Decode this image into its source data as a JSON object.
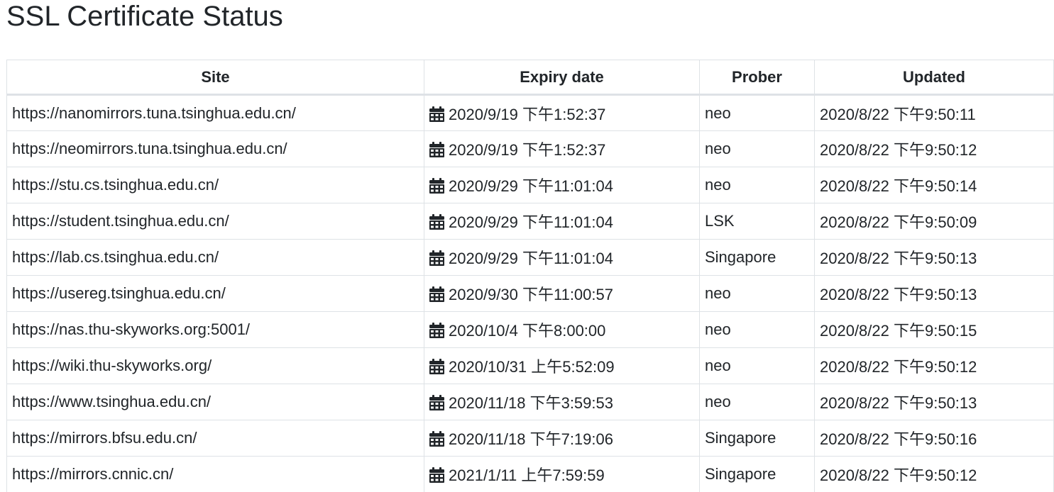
{
  "page": {
    "title": "SSL Certificate Status"
  },
  "table": {
    "headers": {
      "site": "Site",
      "expiry": "Expiry date",
      "prober": "Prober",
      "updated": "Updated"
    },
    "expiry_icon": "calendar-icon",
    "rows": [
      {
        "site": "https://nanomirrors.tuna.tsinghua.edu.cn/",
        "expiry": "2020/9/19 下午1:52:37",
        "prober": "neo",
        "updated": "2020/8/22 下午9:50:11"
      },
      {
        "site": "https://neomirrors.tuna.tsinghua.edu.cn/",
        "expiry": "2020/9/19 下午1:52:37",
        "prober": "neo",
        "updated": "2020/8/22 下午9:50:12"
      },
      {
        "site": "https://stu.cs.tsinghua.edu.cn/",
        "expiry": "2020/9/29 下午11:01:04",
        "prober": "neo",
        "updated": "2020/8/22 下午9:50:14"
      },
      {
        "site": "https://student.tsinghua.edu.cn/",
        "expiry": "2020/9/29 下午11:01:04",
        "prober": "LSK",
        "updated": "2020/8/22 下午9:50:09"
      },
      {
        "site": "https://lab.cs.tsinghua.edu.cn/",
        "expiry": "2020/9/29 下午11:01:04",
        "prober": "Singapore",
        "updated": "2020/8/22 下午9:50:13"
      },
      {
        "site": "https://usereg.tsinghua.edu.cn/",
        "expiry": "2020/9/30 下午11:00:57",
        "prober": "neo",
        "updated": "2020/8/22 下午9:50:13"
      },
      {
        "site": "https://nas.thu-skyworks.org:5001/",
        "expiry": "2020/10/4 下午8:00:00",
        "prober": "neo",
        "updated": "2020/8/22 下午9:50:15"
      },
      {
        "site": "https://wiki.thu-skyworks.org/",
        "expiry": "2020/10/31 上午5:52:09",
        "prober": "neo",
        "updated": "2020/8/22 下午9:50:12"
      },
      {
        "site": "https://www.tsinghua.edu.cn/",
        "expiry": "2020/11/18 下午3:59:53",
        "prober": "neo",
        "updated": "2020/8/22 下午9:50:13"
      },
      {
        "site": "https://mirrors.bfsu.edu.cn/",
        "expiry": "2020/11/18 下午7:19:06",
        "prober": "Singapore",
        "updated": "2020/8/22 下午9:50:16"
      },
      {
        "site": "https://mirrors.cnnic.cn/",
        "expiry": "2021/1/11 上午7:59:59",
        "prober": "Singapore",
        "updated": "2020/8/22 下午9:50:12"
      }
    ]
  }
}
